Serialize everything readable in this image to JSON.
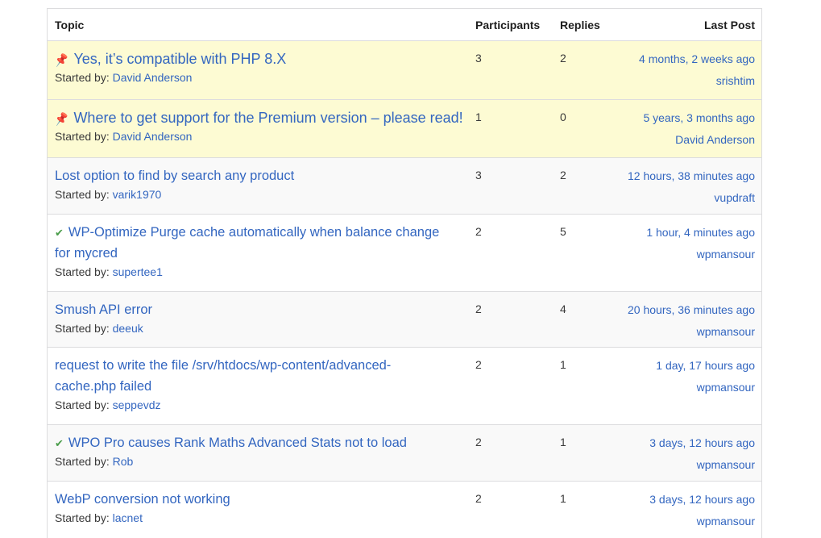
{
  "header": {
    "topic": "Topic",
    "participants": "Participants",
    "replies": "Replies",
    "last_post": "Last Post"
  },
  "started_label": "Started by:",
  "topics": [
    {
      "title": "Yes, it’s compatible with PHP 8.X",
      "author": "David Anderson",
      "participants": "3",
      "replies": "2",
      "last_time": "4 months, 2 weeks ago",
      "last_user": "srishtim",
      "icon": "pin-icon"
    },
    {
      "title": "Where to get support for the Premium version – please read!",
      "author": "David Anderson",
      "participants": "1",
      "replies": "0",
      "last_time": "5 years, 3 months ago",
      "last_user": "David Anderson",
      "icon": "pin-icon"
    },
    {
      "title": "Lost option to find by search any product",
      "author": "varik1970",
      "participants": "3",
      "replies": "2",
      "last_time": "12 hours, 38 minutes ago",
      "last_user": "vupdraft",
      "icon": ""
    },
    {
      "title": "WP-Optimize Purge cache automatically when balance change for mycred",
      "author": "supertee1",
      "participants": "2",
      "replies": "5",
      "last_time": "1 hour, 4 minutes ago",
      "last_user": "wpmansour",
      "icon": "check-icon"
    },
    {
      "title": "Smush API error",
      "author": "deeuk",
      "participants": "2",
      "replies": "4",
      "last_time": "20 hours, 36 minutes ago",
      "last_user": "wpmansour",
      "icon": ""
    },
    {
      "title": "request to write the file /srv/htdocs/wp-content/advanced-cache.php failed",
      "author": "seppevdz",
      "participants": "2",
      "replies": "1",
      "last_time": "1 day, 17 hours ago",
      "last_user": "wpmansour",
      "icon": ""
    },
    {
      "title": "WPO Pro causes Rank Maths Advanced Stats not to load",
      "author": "Rob",
      "participants": "2",
      "replies": "1",
      "last_time": "3 days, 12 hours ago",
      "last_user": "wpmansour",
      "icon": "check-icon"
    },
    {
      "title": "WebP conversion not working",
      "author": "lacnet",
      "participants": "2",
      "replies": "1",
      "last_time": "3 days, 12 hours ago",
      "last_user": "wpmansour",
      "icon": ""
    }
  ],
  "colors": {
    "link": "#3366c0",
    "sticky_bg": "#fdfbd3",
    "row_bg": "#f9f9f9",
    "pin": "#e8a93a",
    "check": "#4a9d4a"
  }
}
